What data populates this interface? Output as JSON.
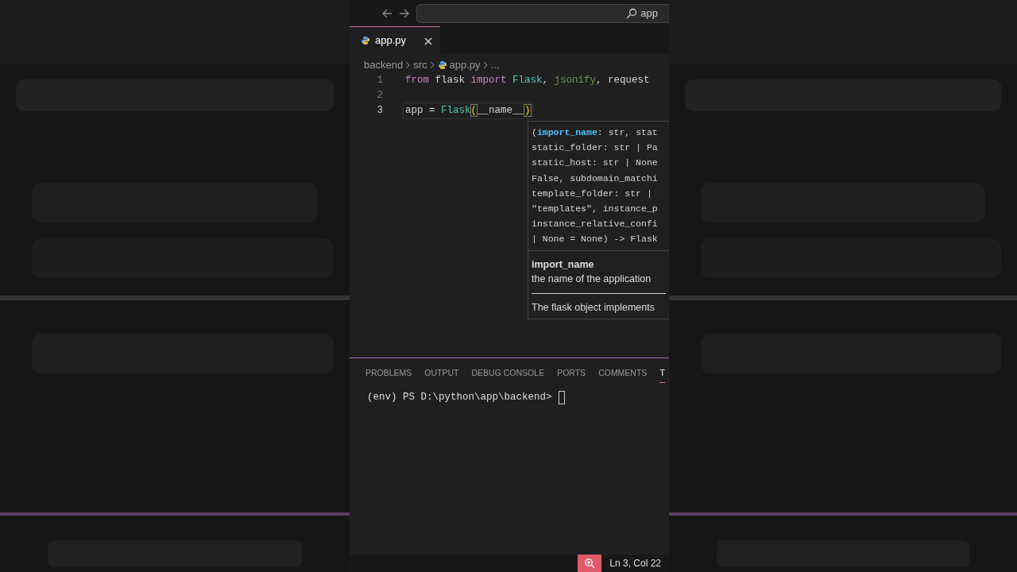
{
  "title_bar": {
    "search": {
      "value": "app"
    }
  },
  "tabs": [
    {
      "label": "app.py",
      "selected": true
    }
  ],
  "breadcrumb": [
    {
      "label": "backend",
      "kind": "folder"
    },
    {
      "label": "src",
      "kind": "folder"
    },
    {
      "label": "app.py",
      "kind": "file"
    },
    {
      "label": "...",
      "kind": "more"
    }
  ],
  "code_lines": [
    {
      "number": "1",
      "current": false,
      "tokens": [
        {
          "text": "from",
          "kind": "keyword"
        },
        {
          "text": " flask ",
          "kind": "plain"
        },
        {
          "text": "import",
          "kind": "keyword"
        },
        {
          "text": " Flask",
          "kind": "class"
        },
        {
          "text": ", ",
          "kind": "plain"
        },
        {
          "text": "jsonify",
          "kind": "function"
        },
        {
          "text": ", request",
          "kind": "plain"
        }
      ]
    },
    {
      "number": "2",
      "current": false
    },
    {
      "number": "3",
      "current": true,
      "tokens": [
        {
          "text": "app",
          "kind": "plain"
        },
        {
          "text": " = ",
          "kind": "operator"
        },
        {
          "text": "Flask",
          "kind": "class"
        },
        {
          "text": "(",
          "kind": "bracket"
        },
        {
          "text": "__name__",
          "kind": "plain"
        },
        {
          "text": ")",
          "kind": "bracket"
        }
      ]
    }
  ],
  "hover": {
    "signature": [
      [
        {
          "text": "(",
          "kind": "plain"
        },
        {
          "text": "import_name",
          "kind": "param"
        },
        {
          "text": ": str, stat",
          "kind": "plain"
        }
      ],
      [
        {
          "text": "static_folder: str | Pa",
          "kind": "plain"
        }
      ],
      [
        {
          "text": "static_host: str | None",
          "kind": "plain"
        }
      ],
      [
        {
          "text": "False, subdomain_matchi",
          "kind": "plain"
        }
      ],
      [
        {
          "text": "template_folder: str |",
          "kind": "plain"
        }
      ],
      [
        {
          "text": "\"templates\", instance_p",
          "kind": "plain"
        }
      ],
      [
        {
          "text": "instance_relative_confi",
          "kind": "plain"
        }
      ],
      [
        {
          "text": "| None = None) -> Flask",
          "kind": "plain"
        }
      ]
    ],
    "param_name": "import_name",
    "param_doc": "the name of the application",
    "description": "The flask object implements"
  },
  "panel": {
    "tabs": [
      {
        "label": "PROBLEMS",
        "selected": false
      },
      {
        "label": "OUTPUT",
        "selected": false
      },
      {
        "label": "DEBUG CONSOLE",
        "selected": false
      },
      {
        "label": "PORTS",
        "selected": false
      },
      {
        "label": "COMMENTS",
        "selected": false
      },
      {
        "label": "T",
        "selected": true
      }
    ],
    "prompt": "(env) PS D:\\python\\app\\backend>"
  },
  "status_bar": {
    "cursor": "Ln 3, Col 22"
  }
}
